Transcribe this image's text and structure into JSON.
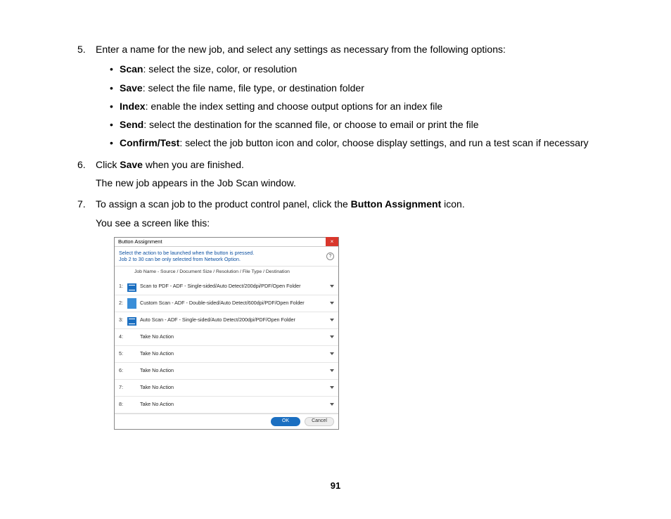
{
  "steps": {
    "s5": {
      "num": "5.",
      "text_before": "Enter a name for the new job, and select any settings as necessary from the following options:",
      "bullets": [
        {
          "label": "Scan",
          "rest": ": select the size, color, or resolution"
        },
        {
          "label": "Save",
          "rest": ": select the file name, file type, or destination folder"
        },
        {
          "label": "Index",
          "rest": ": enable the index setting and choose output options for an index file"
        },
        {
          "label": "Send",
          "rest": ": select the destination for the scanned file, or choose to email or print the file"
        },
        {
          "label": "Confirm/Test",
          "rest": ": select the job button icon and color, choose display settings, and run a test scan if necessary"
        }
      ]
    },
    "s6": {
      "num": "6.",
      "text_a": "Click ",
      "bold": "Save",
      "text_b": " when you are finished.",
      "para": "The new job appears in the Job Scan window."
    },
    "s7": {
      "num": "7.",
      "text_a": "To assign a scan job to the product control panel, click the ",
      "bold": "Button Assignment",
      "text_b": " icon.",
      "para": "You see a screen like this:"
    }
  },
  "dialog": {
    "title": "Button Assignment",
    "close": "×",
    "instruction_l1": "Select the action to be launched when the button is pressed.",
    "instruction_l2": "Job 2 to 30 can be only selected from Network Option.",
    "help": "?",
    "header": "Job Name  -  Source / Document Size / Resolution / File Type / Destination",
    "rows": [
      {
        "num": "1:",
        "icon": true,
        "text": "Scan to PDF - ADF - Single-sided/Auto Detect/200dpi/PDF/Open Folder"
      },
      {
        "num": "2:",
        "icon": true,
        "text": "Custom Scan - ADF - Double-sided/Auto Detect/600dpi/PDF/Open Folder"
      },
      {
        "num": "3:",
        "icon": true,
        "text": "Auto Scan - ADF - Single-sided/Auto Detect/200dpi/PDF/Open Folder"
      },
      {
        "num": "4:",
        "icon": false,
        "text": "Take No Action"
      },
      {
        "num": "5:",
        "icon": false,
        "text": "Take No Action"
      },
      {
        "num": "6:",
        "icon": false,
        "text": "Take No Action"
      },
      {
        "num": "7:",
        "icon": false,
        "text": "Take No Action"
      },
      {
        "num": "8:",
        "icon": false,
        "text": "Take No Action"
      }
    ],
    "ok": "OK",
    "cancel": "Cancel"
  },
  "page_number": "91"
}
